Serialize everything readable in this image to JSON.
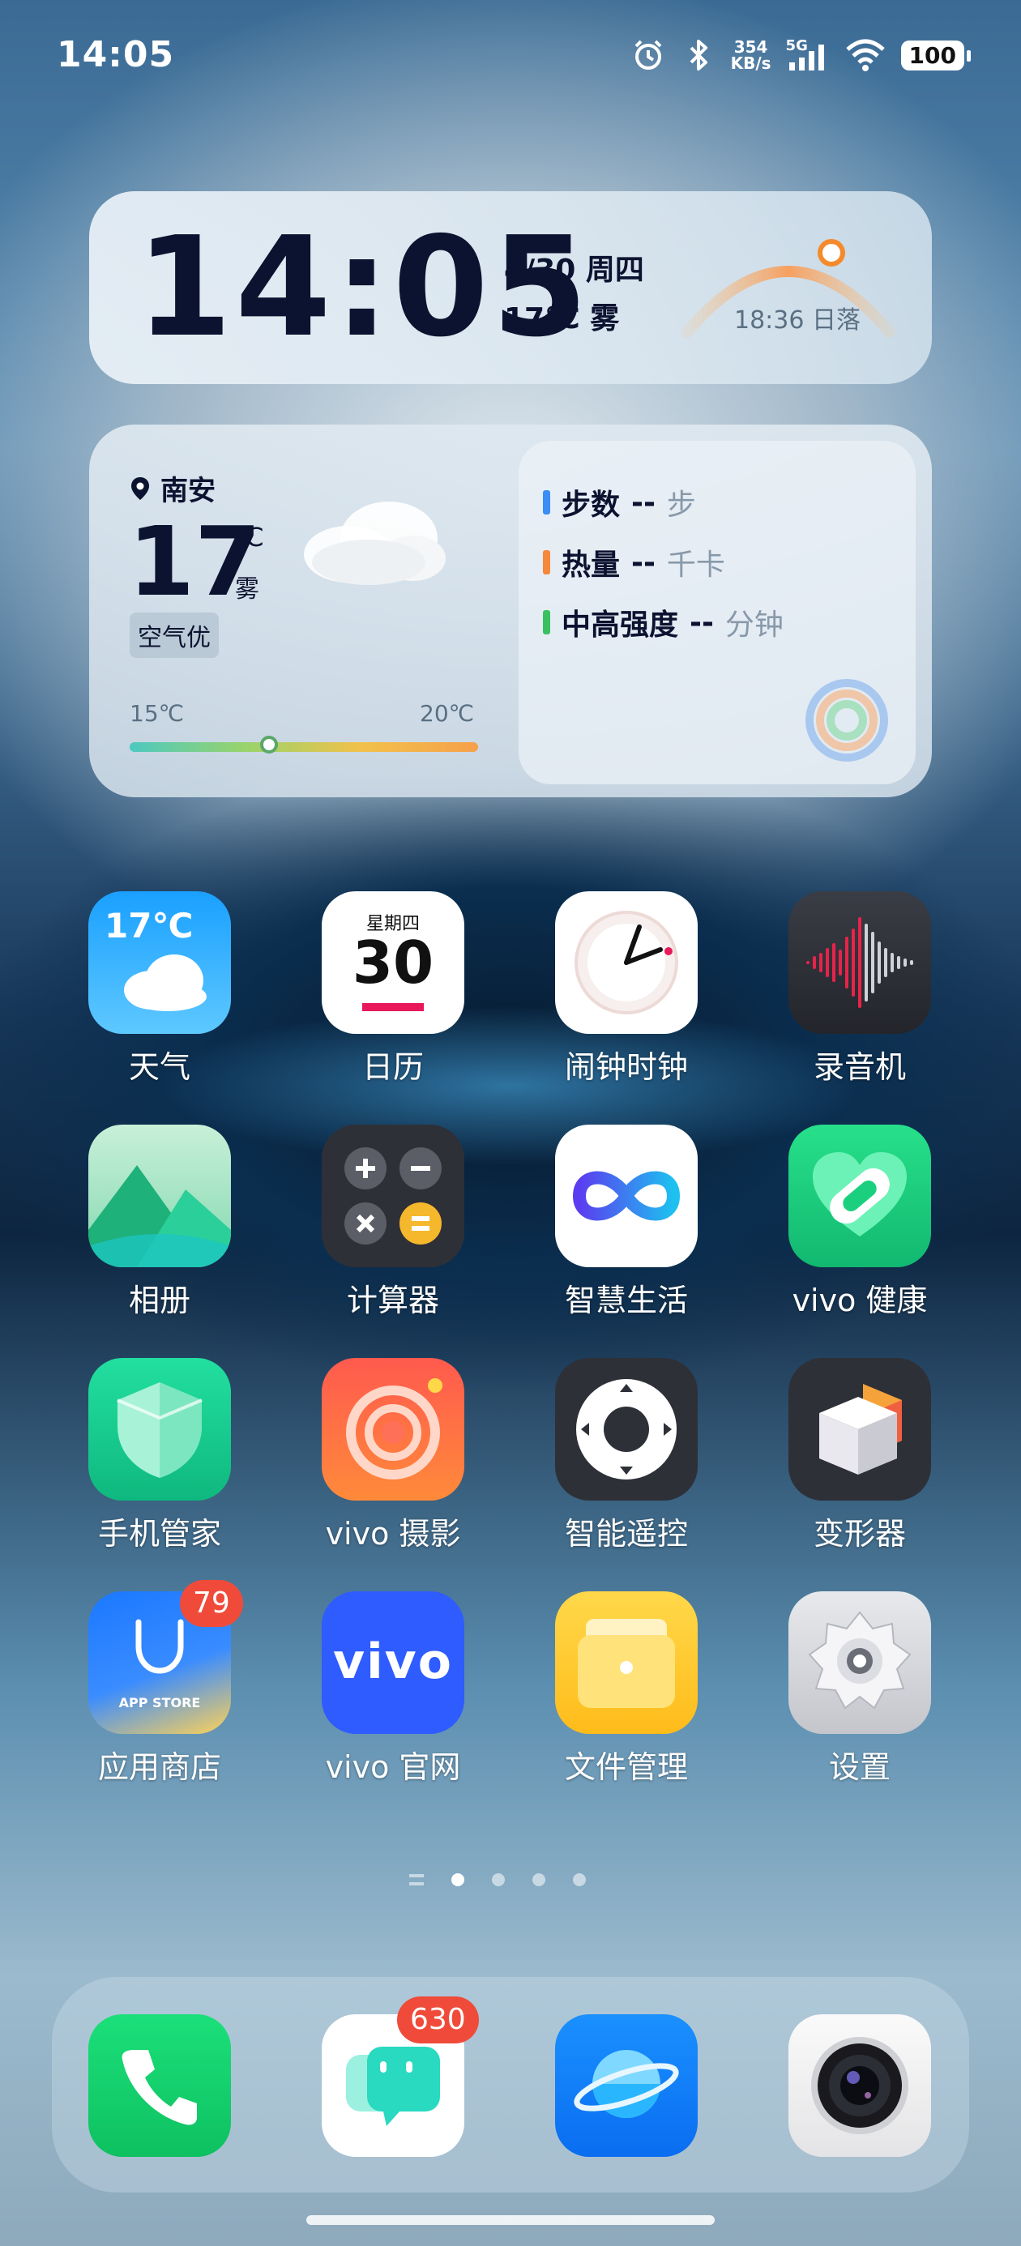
{
  "status_bar": {
    "time": "14:05",
    "net_speed_value": "354",
    "net_speed_unit": "KB/s",
    "network": "5G",
    "battery": "100"
  },
  "clock_widget": {
    "time": "14:05",
    "date": "4/30 周四",
    "weather": "17℃ 雾",
    "sunset": "18:36 日落"
  },
  "weather_widget": {
    "location": "南安",
    "temperature": "17",
    "unit": "℃",
    "condition": "雾",
    "air_quality": "空气优",
    "temp_min": "15℃",
    "temp_max": "20℃",
    "temp_level": 0.4
  },
  "health_widget": {
    "rows": [
      {
        "label": "步数",
        "value": "--",
        "unit": "步",
        "color": "#3a8ef5"
      },
      {
        "label": "热量",
        "value": "--",
        "unit": "千卡",
        "color": "#f5883a"
      },
      {
        "label": "中高强度",
        "value": "--",
        "unit": "分钟",
        "color": "#3ac060"
      }
    ]
  },
  "apps": [
    {
      "label": "天气",
      "icon": "weather-icon",
      "icon_text": "17℃"
    },
    {
      "label": "日历",
      "icon": "calendar-icon",
      "icon_weekday": "星期四",
      "icon_day": "30"
    },
    {
      "label": "闹钟时钟",
      "icon": "clock-icon"
    },
    {
      "label": "录音机",
      "icon": "recorder-icon"
    },
    {
      "label": "相册",
      "icon": "gallery-icon"
    },
    {
      "label": "计算器",
      "icon": "calculator-icon"
    },
    {
      "label": "智慧生活",
      "icon": "smart-life-icon"
    },
    {
      "label": "vivo 健康",
      "icon": "health-icon"
    },
    {
      "label": "手机管家",
      "icon": "phone-manager-icon"
    },
    {
      "label": "vivo 摄影",
      "icon": "camera-app-icon"
    },
    {
      "label": "智能遥控",
      "icon": "remote-icon"
    },
    {
      "label": "变形器",
      "icon": "transformer-icon"
    },
    {
      "label": "应用商店",
      "icon": "app-store-icon",
      "icon_text": "APP STORE",
      "badge": "79"
    },
    {
      "label": "vivo 官网",
      "icon": "vivo-site-icon",
      "icon_text": "vivo"
    },
    {
      "label": "文件管理",
      "icon": "file-manager-icon"
    },
    {
      "label": "设置",
      "icon": "settings-icon"
    }
  ],
  "page_indicator": {
    "pages": 4,
    "active": 1
  },
  "dock": [
    {
      "name": "phone",
      "icon": "phone-icon"
    },
    {
      "name": "messages",
      "icon": "messages-icon",
      "badge": "630"
    },
    {
      "name": "browser",
      "icon": "browser-icon"
    },
    {
      "name": "camera",
      "icon": "camera-icon"
    }
  ]
}
